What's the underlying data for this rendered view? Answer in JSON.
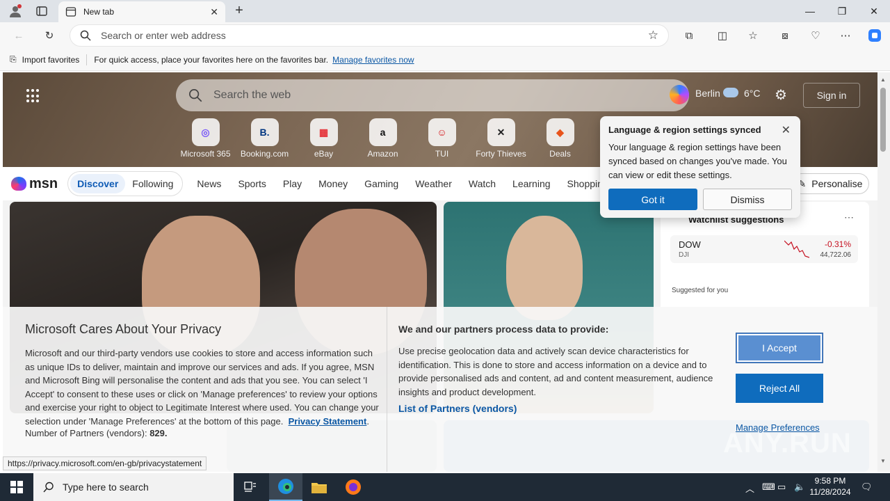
{
  "browser": {
    "tab_title": "New tab",
    "address_placeholder": "Search or enter web address",
    "favbar": {
      "import_label": "Import favorites",
      "hint": "For quick access, place your favorites here on the favorites bar.",
      "manage_link": "Manage favorites now"
    },
    "status_url": "https://privacy.microsoft.com/en-gb/privacystatement"
  },
  "hero": {
    "search_placeholder": "Search the web",
    "city": "Berlin",
    "temperature": "6°C",
    "signin_label": "Sign in",
    "quicklinks": [
      {
        "label": "Microsoft 365",
        "glyph": "◎",
        "color": "#7a5af8"
      },
      {
        "label": "Booking.com",
        "glyph": "B.",
        "color": "#003580"
      },
      {
        "label": "eBay",
        "glyph": "▦",
        "color": "#e53238"
      },
      {
        "label": "Amazon",
        "glyph": "a",
        "color": "#111111"
      },
      {
        "label": "TUI",
        "glyph": "☺",
        "color": "#d40e14"
      },
      {
        "label": "Forty Thieves",
        "glyph": "✕",
        "color": "#222222"
      },
      {
        "label": "Deals",
        "glyph": "◆",
        "color": "#e8541c"
      }
    ]
  },
  "msn_nav": {
    "logo_text": "msn",
    "discover": "Discover",
    "following": "Following",
    "links": [
      "News",
      "Sports",
      "Play",
      "Money",
      "Gaming",
      "Weather",
      "Watch",
      "Learning",
      "Shopping"
    ],
    "personalise": "Personalise"
  },
  "watchlist": {
    "title": "Watchlist suggestions",
    "stock_name": "DOW",
    "stock_sub": "DJI",
    "stock_change": "-0.31%",
    "stock_value": "44,722.06",
    "suggested_label": "Suggested for you"
  },
  "language_popup": {
    "title": "Language & region settings synced",
    "body": "Your language & region settings have been synced based on changes you've made. You can view or edit these settings.",
    "got_it": "Got it",
    "dismiss": "Dismiss"
  },
  "privacy": {
    "title": "Microsoft Cares About Your Privacy",
    "body": "Microsoft and our third-party vendors use cookies to store and access information such as unique IDs to deliver, maintain and improve our services and ads. If you agree, MSN and Microsoft Bing will personalise the content and ads that you see. You can select 'I Accept' to consent to these uses or click on 'Manage preferences' to review your options and exercise your right to object to Legitimate Interest where used. You can change your selection under 'Manage Preferences' at the bottom of this page.",
    "statement_link": "Privacy Statement",
    "partners_label": "Number of Partners (vendors):",
    "partners_count": "829.",
    "mid_title": "We and our partners process data to provide:",
    "mid_body": "Use precise geolocation data and actively scan device characteristics for identification. This is done to store and access information on a device and to provide personalised ads and content, ad and content measurement, audience insights and product development.",
    "partners_link": "List of Partners (vendors)",
    "accept": "I Accept",
    "reject": "Reject All",
    "manage": "Manage Preferences"
  },
  "watermark": "ANY.RUN",
  "taskbar": {
    "search_placeholder": "Type here to search",
    "time": "9:58 PM",
    "date": "11/28/2024"
  }
}
